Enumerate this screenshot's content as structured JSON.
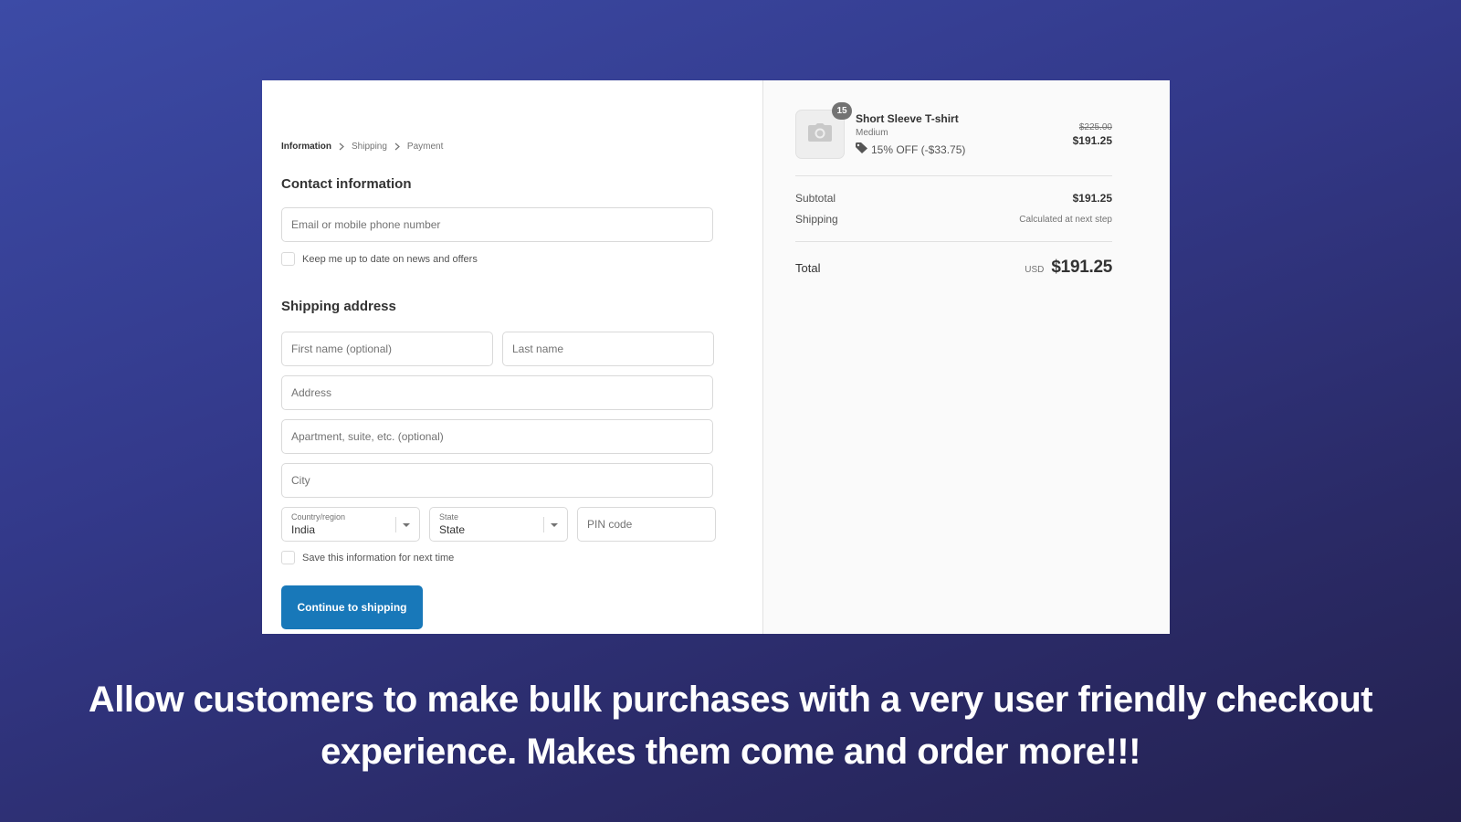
{
  "colors": {
    "background_top": "#3c4ba6",
    "background_bottom": "#24214f",
    "primary_button": "#1878b9",
    "summary_bg": "#fafafa"
  },
  "breadcrumb": [
    {
      "label": "Information",
      "active": true
    },
    {
      "label": "Shipping",
      "active": false
    },
    {
      "label": "Payment",
      "active": false
    }
  ],
  "contact": {
    "title": "Contact information",
    "email_placeholder": "Email or mobile phone number",
    "newsletter_label": "Keep me up to date on news and offers"
  },
  "shipping": {
    "title": "Shipping address",
    "first_name_placeholder": "First name (optional)",
    "last_name_placeholder": "Last name",
    "address_placeholder": "Address",
    "apartment_placeholder": "Apartment, suite, etc. (optional)",
    "city_placeholder": "City",
    "country_label": "Country/region",
    "country_value": "India",
    "state_label": "State",
    "state_value": "State",
    "pin_placeholder": "PIN code",
    "save_info_label": "Save this information for next time",
    "continue_button": "Continue to shipping"
  },
  "summary": {
    "product": {
      "name": "Short Sleeve T-shirt",
      "variant": "Medium",
      "quantity": "15",
      "discount": "15% OFF (-$33.75)",
      "original_price": "$225.00",
      "price": "$191.25",
      "thumbnail_icon": "camera-icon",
      "discount_icon": "tag-icon"
    },
    "subtotal_label": "Subtotal",
    "subtotal_value": "$191.25",
    "shipping_label": "Shipping",
    "shipping_value": "Calculated at next step",
    "total_label": "Total",
    "total_currency": "USD",
    "total_value": "$191.25"
  },
  "caption": {
    "line1": "Allow customers to make bulk purchases with a very user friendly checkout",
    "line2": "experience. Makes them come and order more!!!"
  }
}
